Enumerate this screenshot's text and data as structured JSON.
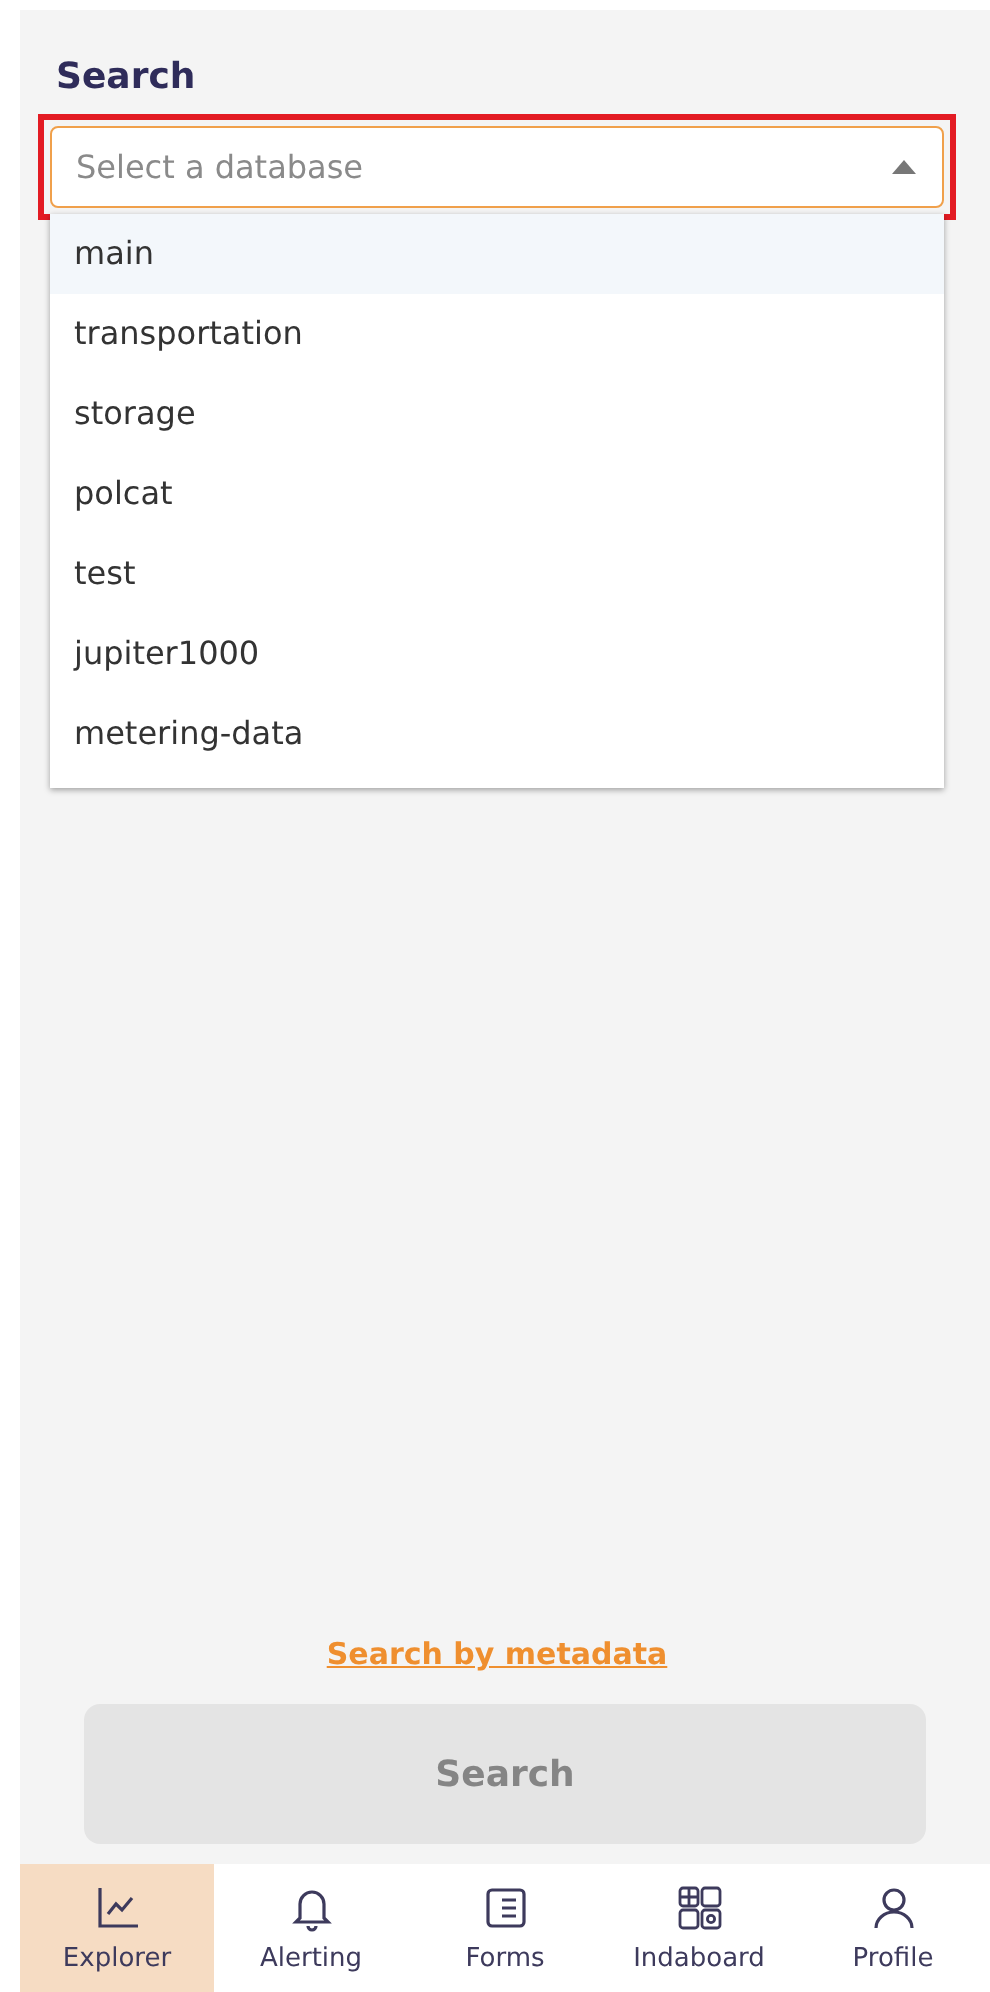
{
  "heading": "Search",
  "select": {
    "placeholder": "Select a database",
    "expanded": true,
    "highlighted": true
  },
  "options": [
    {
      "label": "main",
      "selected": true
    },
    {
      "label": "transportation",
      "selected": false
    },
    {
      "label": "storage",
      "selected": false
    },
    {
      "label": "polcat",
      "selected": false
    },
    {
      "label": "test",
      "selected": false
    },
    {
      "label": "jupiter1000",
      "selected": false
    },
    {
      "label": "metering-data",
      "selected": false
    }
  ],
  "metadata_link": "Search by metadata",
  "search_button": {
    "label": "Search",
    "disabled": true
  },
  "nav": [
    {
      "label": "Explorer",
      "selected": true
    },
    {
      "label": "Alerting",
      "selected": false
    },
    {
      "label": "Forms",
      "selected": false
    },
    {
      "label": "Indaboard",
      "selected": false
    },
    {
      "label": "Profile",
      "selected": false
    }
  ]
}
